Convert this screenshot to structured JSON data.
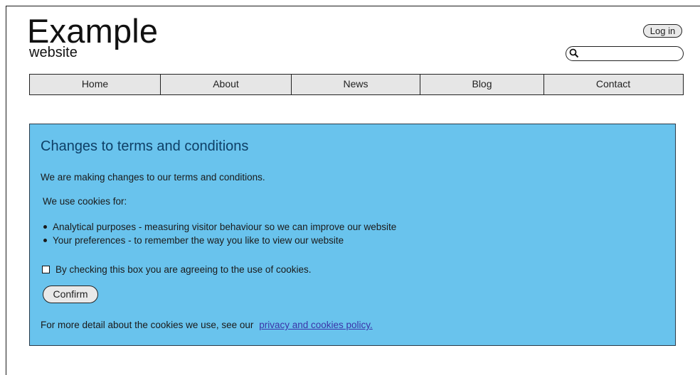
{
  "header": {
    "logo_title": "Example",
    "logo_subtitle": "website",
    "login_label": "Log in",
    "search_placeholder": ""
  },
  "nav": {
    "items": [
      {
        "label": "Home"
      },
      {
        "label": "About"
      },
      {
        "label": "News"
      },
      {
        "label": "Blog"
      },
      {
        "label": "Contact"
      }
    ]
  },
  "notice": {
    "title": "Changes to terms and conditions",
    "intro": "We are making changes to our terms and conditions.",
    "cookies_intro": "We use cookies for:",
    "uses": [
      "Analytical purposes - measuring visitor behaviour so we can improve our website",
      "Your preferences - to remember the way you like to view our website"
    ],
    "consent_label": "By checking this box you are agreeing to the use of cookies.",
    "consent_checked": false,
    "confirm_label": "Confirm",
    "more_text": "For more detail about the cookies we use, see our",
    "policy_link": "privacy and cookies policy."
  },
  "colors": {
    "panel_bg": "#69c3ed",
    "title_color": "#0e3f66",
    "link_color": "#3a34a8"
  }
}
